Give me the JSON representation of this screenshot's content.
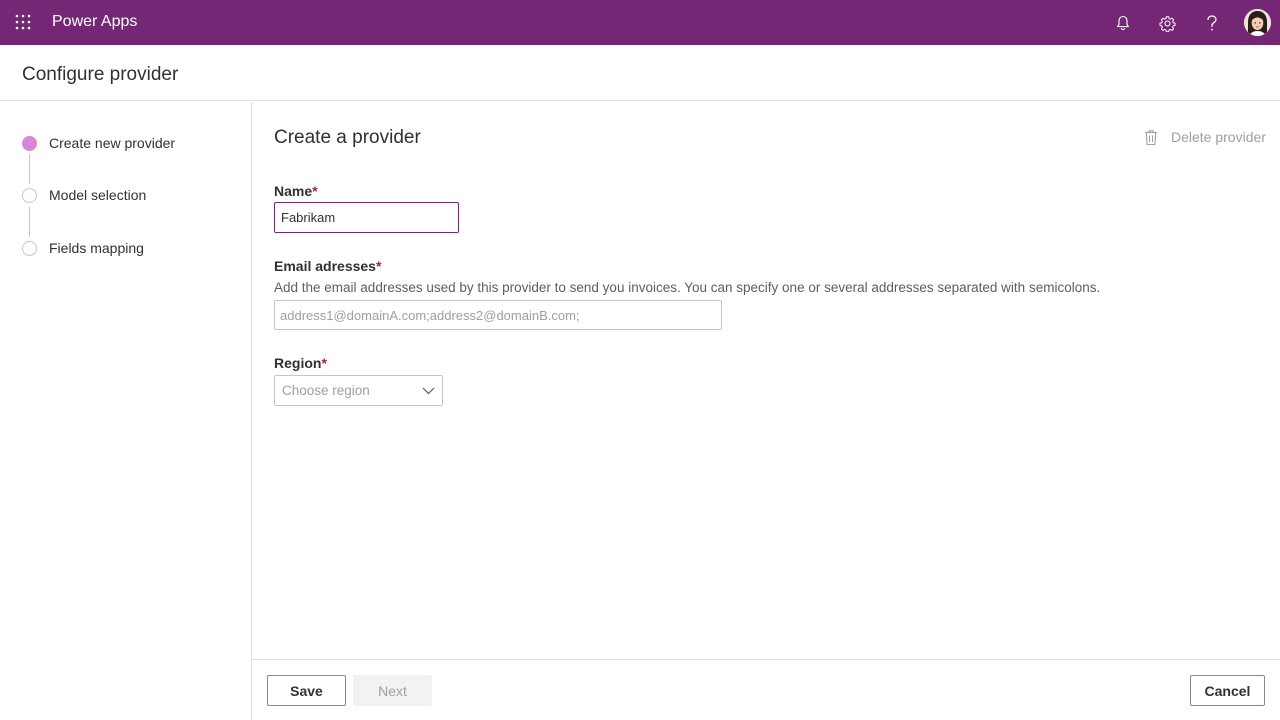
{
  "app": {
    "title": "Power Apps",
    "brand_color": "#742774",
    "icons": [
      "waffle-icon",
      "bell-icon",
      "gear-icon",
      "help-icon",
      "avatar"
    ]
  },
  "page": {
    "title": "Configure provider"
  },
  "stepper": {
    "steps": [
      {
        "label": "Create new provider",
        "active": true
      },
      {
        "label": "Model selection",
        "active": false
      },
      {
        "label": "Fields mapping",
        "active": false
      }
    ],
    "active_color": "#d986d9"
  },
  "form": {
    "title": "Create a provider",
    "delete_label": "Delete provider",
    "required_marker": "*",
    "name": {
      "label": "Name",
      "value": "Fabrikam"
    },
    "email": {
      "label": "Email adresses",
      "help": "Add the email addresses used by this provider to send you invoices. You can specify one or several addresses separated with semicolons.",
      "placeholder": "address1@domainA.com;address2@domainB.com;",
      "value": ""
    },
    "region": {
      "label": "Region",
      "placeholder": "Choose region"
    }
  },
  "footer": {
    "save_label": "Save",
    "next_label": "Next",
    "cancel_label": "Cancel"
  }
}
